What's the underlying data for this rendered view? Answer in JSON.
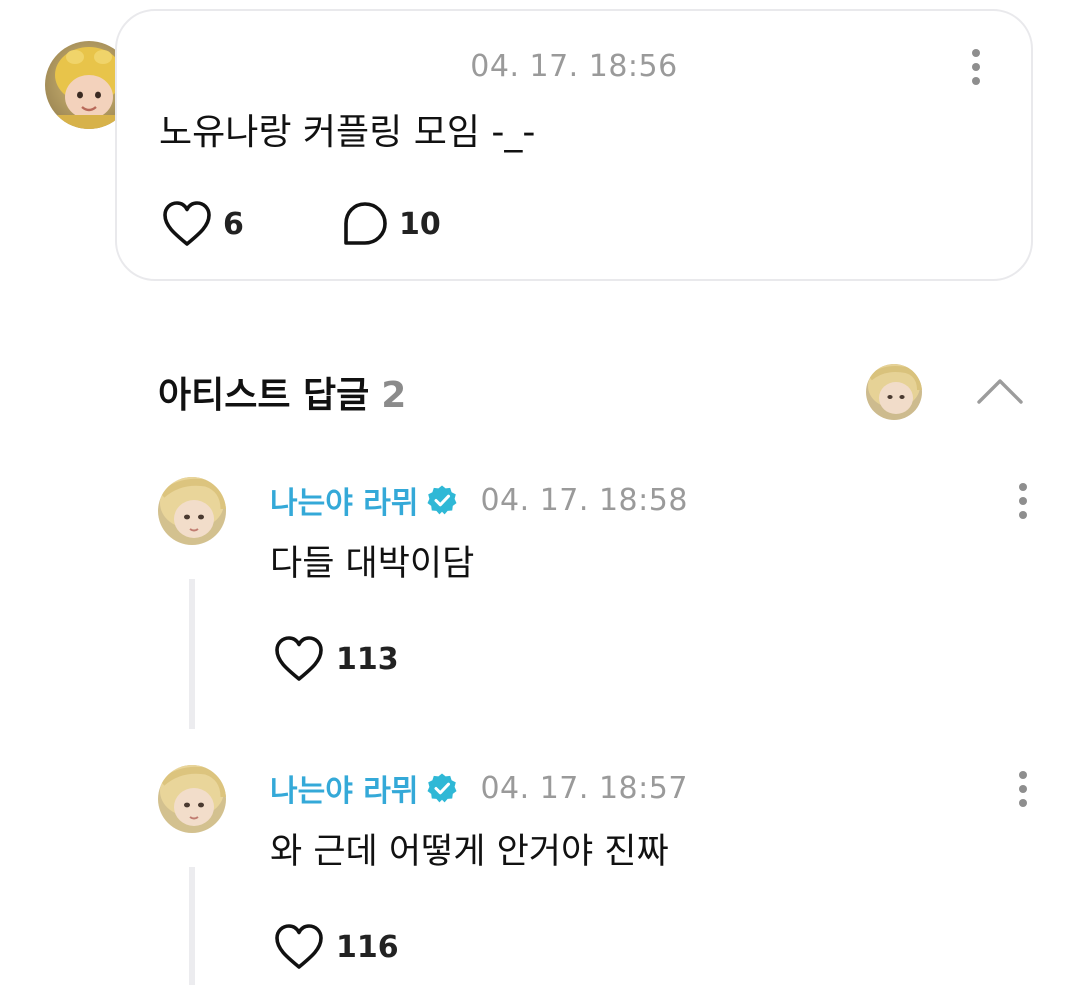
{
  "post": {
    "timestamp": "04. 17. 18:56",
    "text": "노유나랑 커플링 모임 -_-",
    "like_count": "6",
    "comment_count": "10",
    "avatar_icon": "user-avatar-yellow-hood"
  },
  "artist_replies": {
    "title": "아티스트 답글",
    "count": "2",
    "artist_avatar_icon": "artist-avatar",
    "collapse_icon": "chevron-up-icon"
  },
  "comments": [
    {
      "author": "나는야 라뮈",
      "verified_icon": "verified-badge-icon",
      "timestamp": "04. 17. 18:58",
      "text": "다들 대박이담",
      "like_count": "113"
    },
    {
      "author": "나는야 라뮈",
      "verified_icon": "verified-badge-icon",
      "timestamp": "04. 17. 18:57",
      "text": "와 근데 어떻게 안거야 진짜",
      "like_count": "116"
    }
  ],
  "colors": {
    "accent_author": "#34a9d8",
    "verified_badge": "#2fb8d6",
    "timestamp_gray": "#9a9a9a",
    "card_border": "#e9e9ec"
  }
}
